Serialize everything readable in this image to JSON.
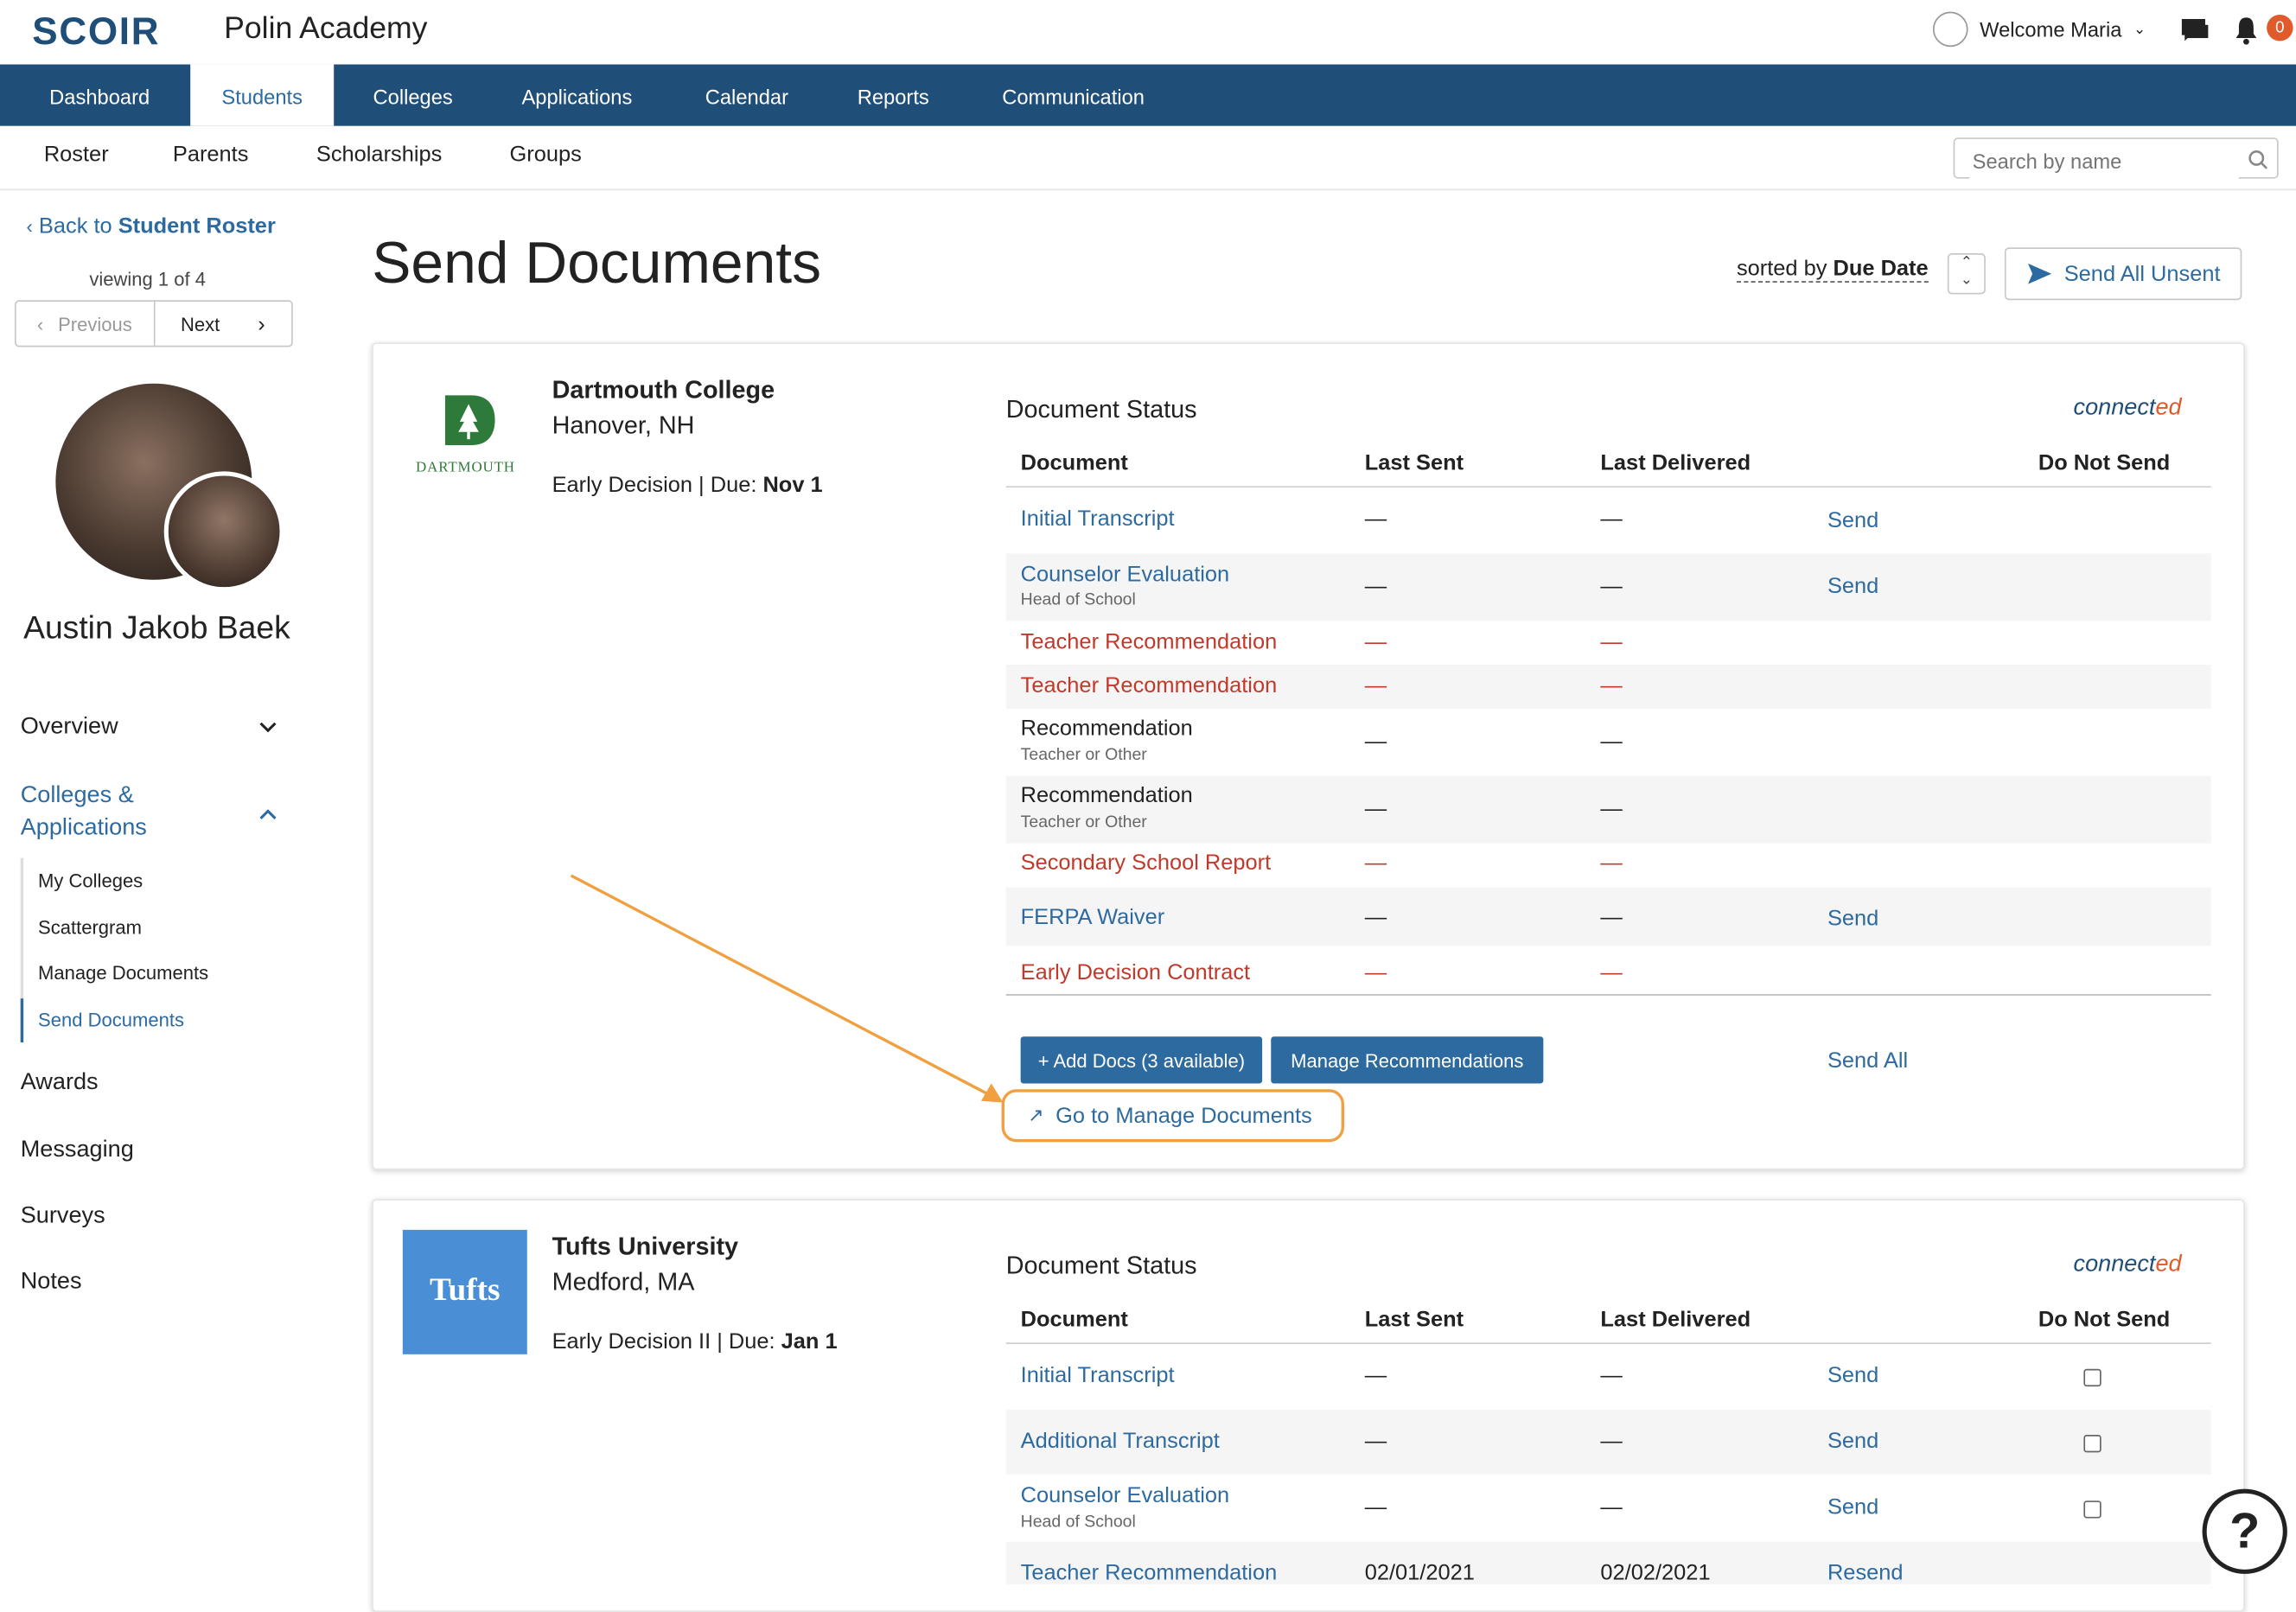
{
  "header": {
    "logo": "SCOIR",
    "school": "Polin Academy",
    "welcome": "Welcome Maria",
    "notification_count": "0"
  },
  "nav": {
    "items": [
      "Dashboard",
      "Students",
      "Colleges",
      "Applications",
      "Calendar",
      "Reports",
      "Communication"
    ],
    "active": "Students",
    "search_placeholder": "Search by name"
  },
  "subnav": {
    "items": [
      "Roster",
      "Parents",
      "Scholarships",
      "Groups"
    ]
  },
  "sidebar": {
    "back_prefix": "Back to",
    "back_target": "Student Roster",
    "viewing": "viewing 1 of 4",
    "prev": "Previous",
    "next": "Next",
    "student_name": "Austin Jakob Baek",
    "overview": "Overview",
    "colleges_apps_1": "Colleges &",
    "colleges_apps_2": "Applications",
    "sub_items": [
      "My Colleges",
      "Scattergram",
      "Manage Documents",
      "Send Documents"
    ],
    "active_sub": "Send Documents",
    "menu_items": [
      "Awards",
      "Messaging",
      "Surveys",
      "Notes"
    ]
  },
  "main": {
    "title": "Send Documents",
    "sorted_prefix": "sorted by",
    "sorted_value": "Due Date",
    "send_all_unsent": "Send All Unsent"
  },
  "table_headers": {
    "document": "Document",
    "last_sent": "Last Sent",
    "last_delivered": "Last Delivered",
    "do_not_send": "Do Not Send"
  },
  "colleges": [
    {
      "name": "Dartmouth College",
      "location": "Hanover, NH",
      "plan": "Early Decision",
      "due_label": "Due:",
      "due": "Nov 1",
      "logo_text": "DARTMOUTH",
      "status_title": "Document Status",
      "connected_a": "connect",
      "connected_b": "ed",
      "docs": [
        {
          "name": "Initial Transcript",
          "sub": "",
          "sent": "—",
          "delivered": "—",
          "action": "Send",
          "color": "blue"
        },
        {
          "name": "Counselor Evaluation",
          "sub": "Head of School",
          "sent": "—",
          "delivered": "—",
          "action": "Send",
          "color": "blue"
        },
        {
          "name": "Teacher Recommendation",
          "sub": "",
          "sent": "—",
          "delivered": "—",
          "action": "",
          "color": "red"
        },
        {
          "name": "Teacher Recommendation",
          "sub": "",
          "sent": "—",
          "delivered": "—",
          "action": "",
          "color": "red"
        },
        {
          "name": "Recommendation",
          "sub": "Teacher or Other",
          "sent": "—",
          "delivered": "—",
          "action": "",
          "color": "plain"
        },
        {
          "name": "Recommendation",
          "sub": "Teacher or Other",
          "sent": "—",
          "delivered": "—",
          "action": "",
          "color": "plain"
        },
        {
          "name": "Secondary School Report",
          "sub": "",
          "sent": "—",
          "delivered": "—",
          "action": "",
          "color": "red"
        },
        {
          "name": "FERPA Waiver",
          "sub": "",
          "sent": "—",
          "delivered": "—",
          "action": "Send",
          "color": "blue"
        },
        {
          "name": "Early Decision Contract",
          "sub": "",
          "sent": "—",
          "delivered": "—",
          "action": "",
          "color": "red"
        }
      ],
      "add_docs": "+ Add Docs (3 available)",
      "manage_recs": "Manage Recommendations",
      "send_all": "Send All",
      "manage_docs_link": "Go to Manage Documents"
    },
    {
      "name": "Tufts University",
      "location": "Medford, MA",
      "plan": "Early Decision II",
      "due_label": "Due:",
      "due": "Jan 1",
      "logo_text": "Tufts",
      "status_title": "Document Status",
      "connected_a": "connect",
      "connected_b": "ed",
      "docs": [
        {
          "name": "Initial Transcript",
          "sub": "",
          "sent": "—",
          "delivered": "—",
          "action": "Send",
          "color": "blue"
        },
        {
          "name": "Additional Transcript",
          "sub": "",
          "sent": "—",
          "delivered": "—",
          "action": "Send",
          "color": "blue"
        },
        {
          "name": "Counselor Evaluation",
          "sub": "Head of School",
          "sent": "—",
          "delivered": "—",
          "action": "Send",
          "color": "blue"
        },
        {
          "name": "Teacher Recommendation",
          "sub": "",
          "sent": "02/01/2021",
          "delivered": "02/02/2021",
          "action": "Resend",
          "color": "blue"
        }
      ]
    }
  ],
  "help": "?"
}
